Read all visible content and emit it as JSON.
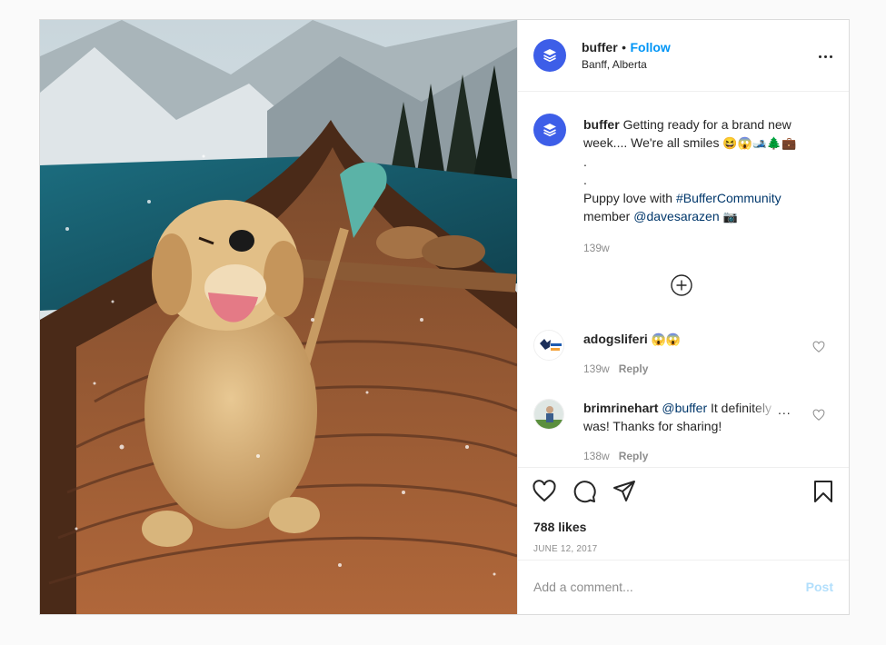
{
  "account": {
    "username": "buffer",
    "separator": "•",
    "follow_label": "Follow",
    "location": "Banff, Alberta",
    "logo_color": "#3d5ee8"
  },
  "caption": {
    "username": "buffer",
    "text1": "Getting ready for a brand new week.... We're all smiles",
    "emojis": "😆😱🎿🌲💼",
    "dot1": ".",
    "dot2": ".",
    "text2": "Puppy love with",
    "hashtag": "#BufferCommunity",
    "text3": "member",
    "mention": "@davesarazen",
    "camera_emoji": "📷",
    "time": "139w"
  },
  "comments": [
    {
      "username": "adogsliferi",
      "text": "😱😱",
      "time": "139w",
      "reply": "Reply"
    },
    {
      "username": "brimrinehart",
      "mention": "@buffer",
      "text_a": "It definitely",
      "text_b": "was! Thanks for sharing!",
      "more": "...",
      "time": "138w",
      "reply": "Reply"
    }
  ],
  "actions": {
    "likes": "788 likes",
    "date": "JUNE 12, 2017"
  },
  "add_comment": {
    "placeholder": "Add a comment...",
    "post_label": "Post"
  },
  "icons": [
    "layers-icon",
    "more-icon",
    "add-circle-icon",
    "heart-icon",
    "comment-icon",
    "share-icon",
    "bookmark-icon"
  ],
  "colors": {
    "link": "#00376b",
    "follow": "#0095f6",
    "post_disabled": "#b2dffc",
    "muted": "#8e8e8e"
  }
}
